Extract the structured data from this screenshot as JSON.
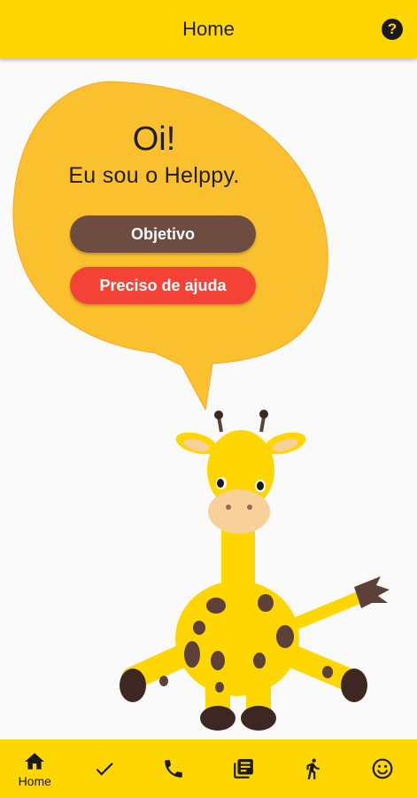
{
  "appbar": {
    "title": "Home",
    "help_icon": "help-circle-icon"
  },
  "bubble": {
    "greeting": "Oi!",
    "intro": "Eu sou o Helppy.",
    "objective_label": "Objetivo",
    "help_label": "Preciso de ajuda"
  },
  "colors": {
    "accent": "#FFD600",
    "bubble": "#FBC02D",
    "objective_button": "#6D4C41",
    "help_button": "#F44336",
    "spots": "#5D4037"
  },
  "navbar": {
    "items": [
      {
        "icon": "home-icon",
        "label": "Home"
      },
      {
        "icon": "check-icon"
      },
      {
        "icon": "phone-icon"
      },
      {
        "icon": "library-icon"
      },
      {
        "icon": "walk-icon"
      },
      {
        "icon": "smiley-icon"
      }
    ]
  }
}
